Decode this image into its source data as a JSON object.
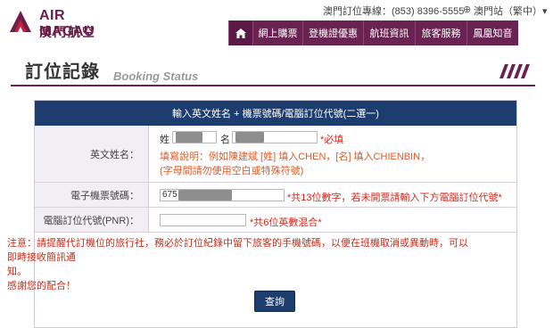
{
  "brand": {
    "name_en": "AIR MACAU",
    "name_zh": "澳門航空"
  },
  "header": {
    "hotline": "澳門訂位專線：(853) 8396-5555",
    "site_selector": "澳門站（繁中）▾"
  },
  "nav": {
    "items": [
      "網上購票",
      "登機證優惠",
      "航班資訊",
      "旅客服務",
      "鳳凰知音"
    ]
  },
  "page": {
    "title": "訂位記錄",
    "subtitle": "Booking Status"
  },
  "form": {
    "header": "輸入英文姓名 + 機票號碼/電腦訂位代號(二選一)",
    "name": {
      "label": "英文姓名：",
      "surname_label": "姓",
      "given_label": "名",
      "required": "*必填",
      "help_line1": "填寫說明：例如陳建斌 [姓] 填入CHEN，[名] 填入CHIENBIN，",
      "help_line2": "(字母間請勿使用空白或特殊符號)"
    },
    "ticket": {
      "label": "電子機票號碼：",
      "value": "675",
      "hint": "*共13位數字，若未開票請輸入下方電腦訂位代號*"
    },
    "pnr": {
      "label": "電腦訂位代號(PNR)：",
      "value": "",
      "hint": "*共6位英數混合*"
    },
    "notice_line1": "注意：請提醒代訂機位的旅行社，務必於訂位紀錄中留下旅客的手機號碼，以便在班機取消或異動時，可以即時接收簡訊通",
    "notice_line2": "知。",
    "notice_line3": "感謝您的配合！",
    "submit_label": "查詢"
  }
}
